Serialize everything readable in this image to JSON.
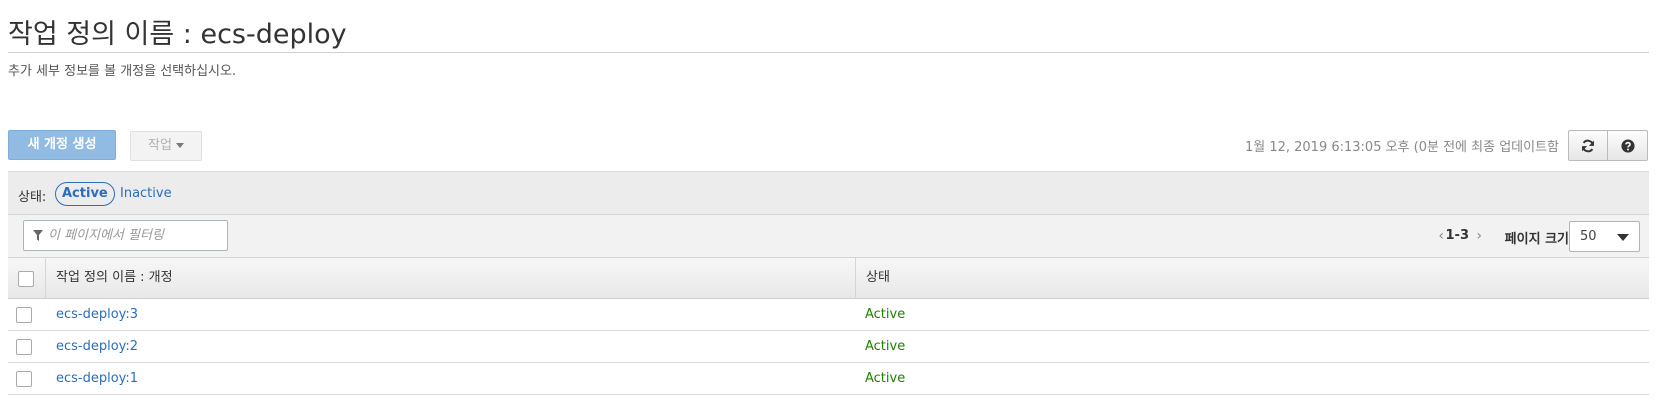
{
  "header": {
    "title": "작업 정의 이름 : ecs-deploy",
    "subtitle": "추가 세부 정보를 볼 개정을 선택하십시오."
  },
  "toolbar": {
    "create_label": "새 개정 생성",
    "actions_label": "작업",
    "last_updated": "1월 12, 2019 6:13:05 오후 (0분 전에 최종 업데이트함",
    "refresh_icon": "refresh-icon",
    "help_icon": "help-icon"
  },
  "status_filter": {
    "label": "상태:",
    "active": "Active",
    "inactive": "Inactive"
  },
  "filter": {
    "placeholder": "이 페이지에서 필터링",
    "range": "1-3",
    "page_size_label": "페이지 크기",
    "page_size_value": "50"
  },
  "table": {
    "columns": [
      "작업 정의 이름 : 개정",
      "상태"
    ],
    "rows": [
      {
        "name": "ecs-deploy:3",
        "status": "Active"
      },
      {
        "name": "ecs-deploy:2",
        "status": "Active"
      },
      {
        "name": "ecs-deploy:1",
        "status": "Active"
      }
    ]
  },
  "colors": {
    "link": "#2a6ebb",
    "status_active": "#1d8102",
    "primary_button": "#92bbe3"
  }
}
